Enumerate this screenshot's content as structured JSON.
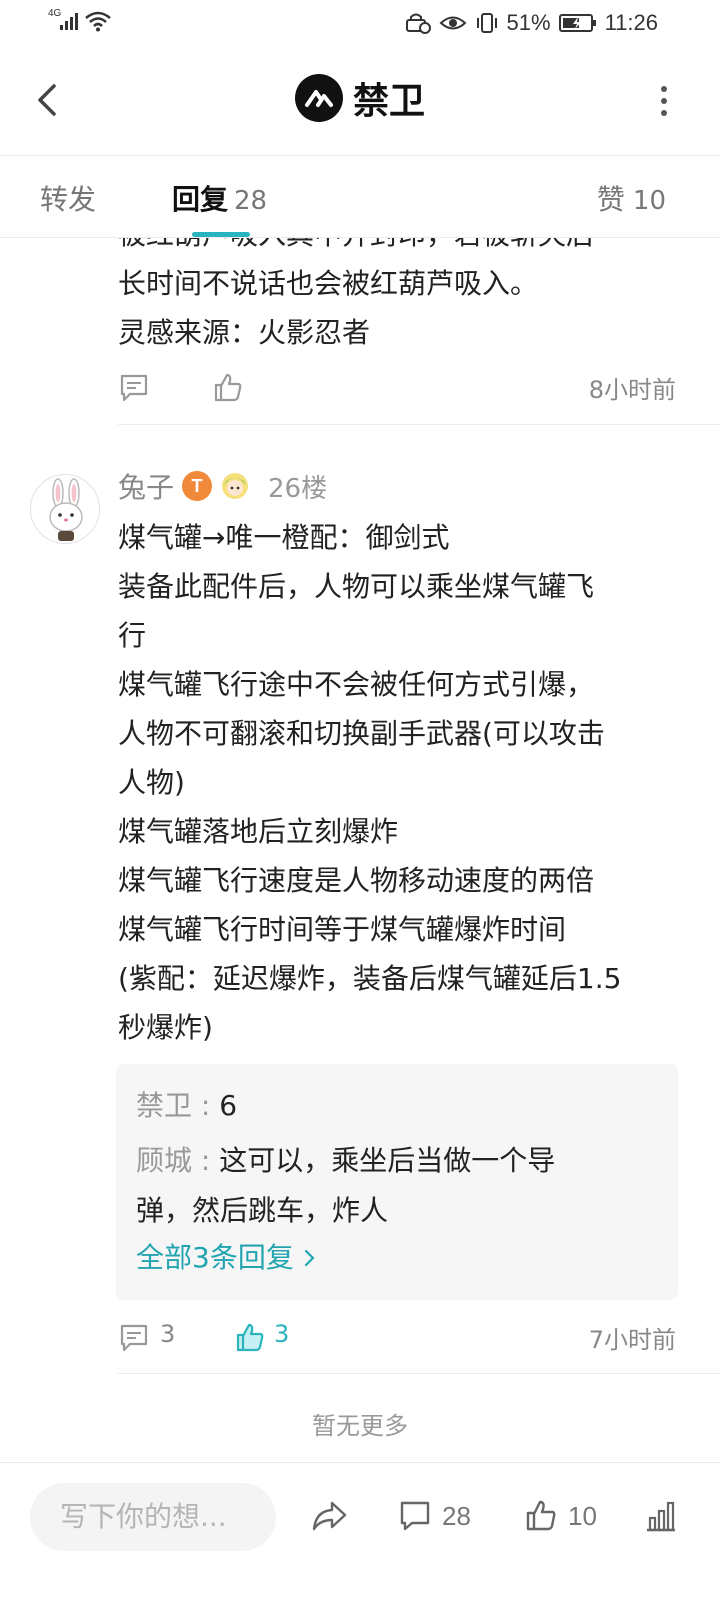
{
  "status_bar": {
    "network": "4G",
    "battery": "51%",
    "time": "11:26"
  },
  "header": {
    "title": "禁卫"
  },
  "tabs": {
    "forward_label": "转发",
    "reply_label": "回复",
    "reply_count": "28",
    "like_label": "赞",
    "like_count": "10"
  },
  "previous_post": {
    "lines": [
      "被红葫芦吸入其中并封印，若被斩灭后",
      "长时间不说话也会被红葫芦吸入。",
      "灵感来源：火影忍者"
    ],
    "time": "8小时前"
  },
  "post": {
    "username": "兔子",
    "level_badge": "T",
    "floor": "26楼",
    "lines": [
      "煤气罐→唯一橙配：御剑式",
      "装备此配件后，人物可以乘坐煤气罐飞",
      "行",
      "煤气罐飞行途中不会被任何方式引爆，",
      "人物不可翻滚和切换副手武器(可以攻击",
      "人物)",
      "煤气罐落地后立刻爆炸",
      "煤气罐飞行速度是人物移动速度的两倍",
      "煤气罐飞行时间等于煤气罐爆炸时间",
      "(紫配：延迟爆炸，装备后煤气罐延后1.5",
      "秒爆炸)"
    ],
    "replies": [
      {
        "name": "禁卫",
        "sep": " : ",
        "text": "6"
      },
      {
        "name": "顾城",
        "sep": " : ",
        "text": "这可以，乘坐后当做一个导",
        "text2": "弹，然后跳车，炸人"
      }
    ],
    "all_replies_label": "全部3条回复",
    "comment_count": "3",
    "like_count": "3",
    "time": "7小时前"
  },
  "no_more_label": "暂无更多",
  "bottom_bar": {
    "input_placeholder": "写下你的想...",
    "comment_count": "28",
    "like_count": "10"
  },
  "colors": {
    "accent": "#29b4be",
    "link": "#22a5b0"
  }
}
